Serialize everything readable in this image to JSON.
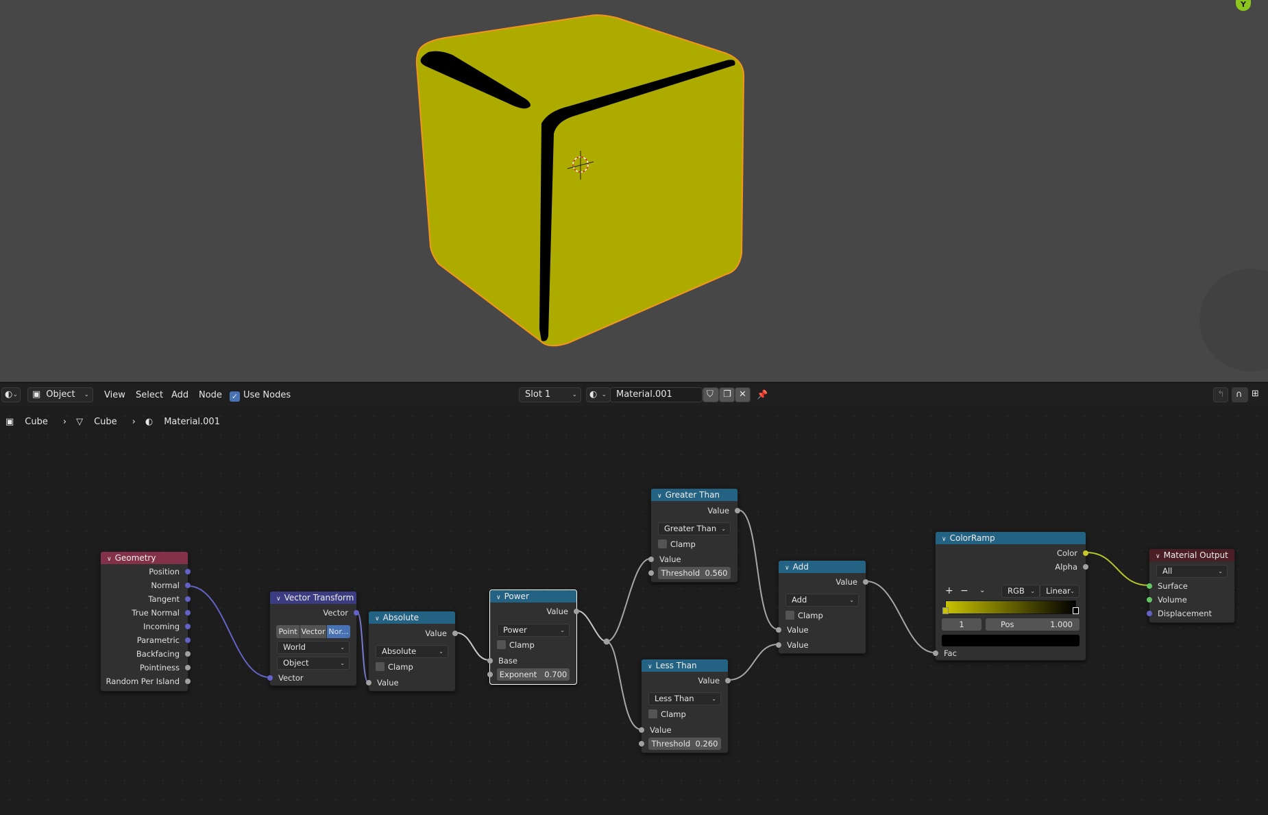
{
  "viewport": {
    "axis_label": "Y",
    "object_color": "#adab00",
    "outline_color": "#f5951d"
  },
  "header": {
    "editor_type_icon": "shader-editor-icon",
    "mode": "Object",
    "menus": [
      "View",
      "Select",
      "Add",
      "Node"
    ],
    "use_nodes_label": "Use Nodes",
    "use_nodes_checked": true,
    "slot": "Slot 1",
    "material_name": "Material.001"
  },
  "breadcrumb": [
    {
      "icon": "object-icon",
      "label": "Cube"
    },
    {
      "icon": "mesh-icon",
      "label": "Cube"
    },
    {
      "icon": "material-icon",
      "label": "Material.001"
    }
  ],
  "nodes": {
    "geometry": {
      "title": "Geometry",
      "outputs": [
        "Position",
        "Normal",
        "Tangent",
        "True Normal",
        "Incoming",
        "Parametric",
        "Backfacing",
        "Pointiness",
        "Random Per Island"
      ]
    },
    "vector_transform": {
      "title": "Vector Transform",
      "output": "Vector",
      "types": [
        "Point",
        "Vector",
        "Nor..."
      ],
      "active_type": "Nor...",
      "convert_from": "World",
      "convert_to": "Object",
      "input": "Vector"
    },
    "absolute": {
      "title": "Absolute",
      "output": "Value",
      "operation": "Absolute",
      "clamp": "Clamp",
      "input": "Value"
    },
    "power": {
      "title": "Power",
      "output": "Value",
      "operation": "Power",
      "clamp": "Clamp",
      "input": "Base",
      "exponent_label": "Exponent",
      "exponent": "0.700"
    },
    "greater_than": {
      "title": "Greater Than",
      "output": "Value",
      "operation": "Greater Than",
      "clamp": "Clamp",
      "input": "Value",
      "threshold_label": "Threshold",
      "threshold": "0.560"
    },
    "less_than": {
      "title": "Less Than",
      "output": "Value",
      "operation": "Less Than",
      "clamp": "Clamp",
      "input": "Value",
      "threshold_label": "Threshold",
      "threshold": "0.260"
    },
    "add": {
      "title": "Add",
      "output": "Value",
      "operation": "Add",
      "clamp": "Clamp",
      "inputs": [
        "Value",
        "Value"
      ]
    },
    "colorramp": {
      "title": "ColorRamp",
      "outputs": [
        "Color",
        "Alpha"
      ],
      "color_mode": "RGB",
      "interpolation": "Linear",
      "stop_index": "1",
      "pos_label": "Pos",
      "pos": "1.000",
      "input": "Fac",
      "start_color": "#c8c200",
      "end_color": "#000000"
    },
    "material_output": {
      "title": "Material Output",
      "target": "All",
      "inputs": [
        "Surface",
        "Volume",
        "Displacement"
      ]
    }
  }
}
